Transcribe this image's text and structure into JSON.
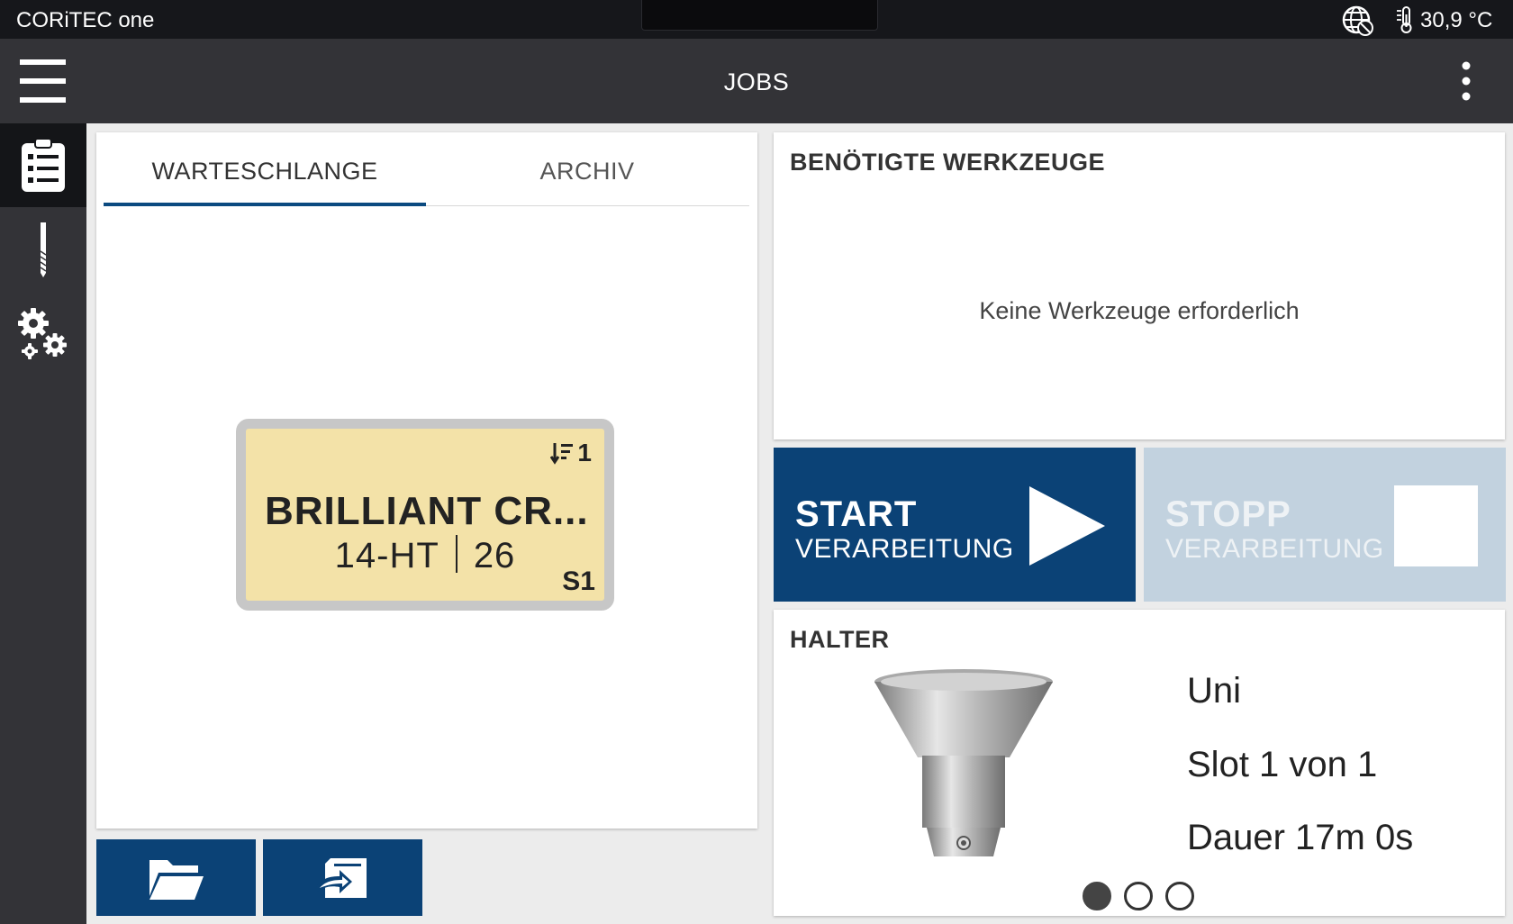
{
  "status_bar": {
    "app_name": "CORiTEC one",
    "temperature": "30,9 °C",
    "icons": [
      "globe-offline-icon",
      "thermometer-icon"
    ]
  },
  "app_bar": {
    "title": "JOBS",
    "icons": [
      "hamburger-menu-icon",
      "more-vert-icon"
    ]
  },
  "sidebar": {
    "items": [
      {
        "name": "jobs",
        "icon": "clipboard-list-icon",
        "active": true
      },
      {
        "name": "tools",
        "icon": "drill-bit-icon",
        "active": false
      },
      {
        "name": "settings",
        "icon": "gears-icon",
        "active": false
      }
    ]
  },
  "queue": {
    "tabs": [
      {
        "label": "WARTESCHLANGE",
        "active": true
      },
      {
        "label": "ARCHIV",
        "active": false
      }
    ],
    "job": {
      "position": "1",
      "name": "BRILLIANT CR...",
      "material": "14-HT",
      "count": "26",
      "slot": "S1"
    },
    "buttons": [
      "open-folder-icon",
      "import-icon"
    ]
  },
  "tools": {
    "title": "BENÖTIGTE WERKZEUGE",
    "empty_text": "Keine Werkzeuge erforderlich"
  },
  "start": {
    "label": "START",
    "sub": "VERARBEITUNG"
  },
  "stop": {
    "label": "STOPP",
    "sub": "VERARBEITUNG"
  },
  "holder": {
    "title": "HALTER",
    "name": "Uni",
    "slot_text": "Slot  1  von  1",
    "duration_text": "Dauer  17m 0s",
    "page_count": 3,
    "active_page": 1
  },
  "colors": {
    "primary": "#0b4276",
    "disabled": "#c2d2df",
    "job_card": "#f3e2a8",
    "bar": "#333337"
  }
}
